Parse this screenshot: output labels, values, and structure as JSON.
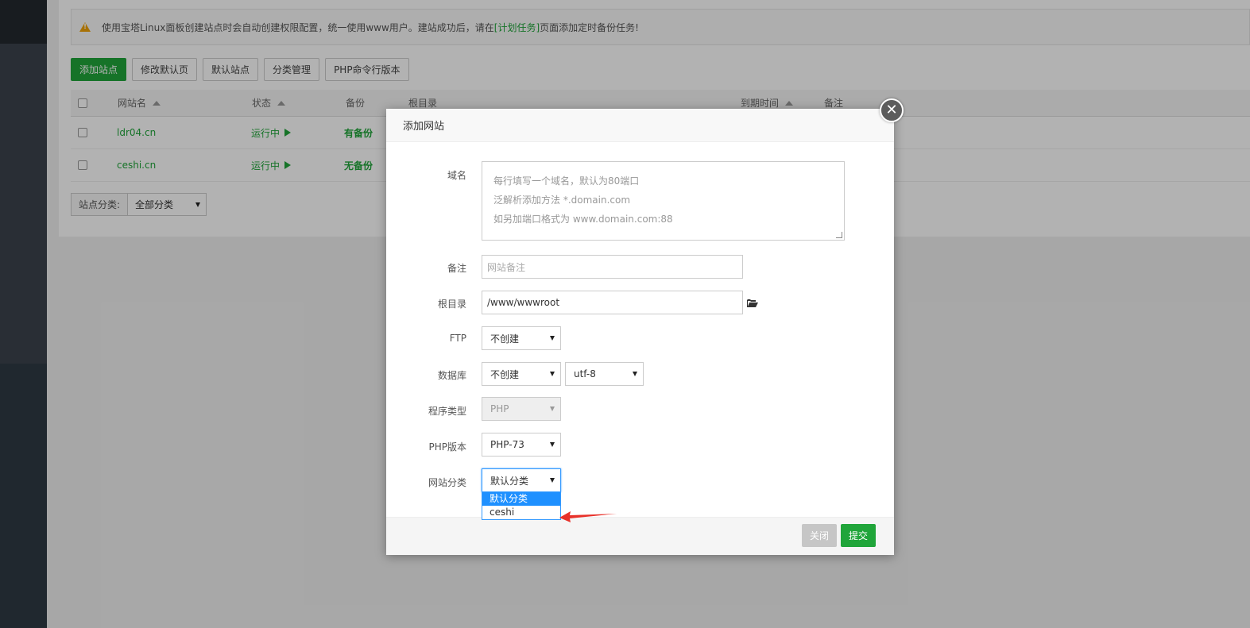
{
  "alert": {
    "text_before": "使用宝塔Linux面板创建站点时会自动创建权限配置，统一使用www用户。建站成功后，请在",
    "link": "[计划任务]",
    "text_after": "页面添加定时备份任务!"
  },
  "toolbar": {
    "add_site": "添加站点",
    "edit_default_page": "修改默认页",
    "default_site": "默认站点",
    "category_manage": "分类管理",
    "php_cli_version": "PHP命令行版本"
  },
  "table": {
    "headers": {
      "site_name": "网站名",
      "status": "状态",
      "backup": "备份",
      "root": "根目录",
      "expire": "到期时间",
      "remark": "备注"
    },
    "rows": [
      {
        "site": "ldr04.cn",
        "status": "运行中",
        "backup": "有备份"
      },
      {
        "site": "ceshi.cn",
        "status": "运行中",
        "backup": "无备份"
      }
    ]
  },
  "category_filter": {
    "label": "站点分类:",
    "selected": "全部分类"
  },
  "modal": {
    "title": "添加网站",
    "close_icon": "close-icon",
    "labels": {
      "domain": "域名",
      "remark": "备注",
      "root": "根目录",
      "ftp": "FTP",
      "database": "数据库",
      "program_type": "程序类型",
      "php_version": "PHP版本",
      "site_category": "网站分类"
    },
    "domain_placeholder": [
      "每行填写一个域名，默认为80端口",
      "泛解析添加方法 *.domain.com",
      "如另加端口格式为 www.domain.com:88"
    ],
    "remark_placeholder": "网站备注",
    "root_value": "/www/wwwroot",
    "ftp_selected": "不创建",
    "db_selected": "不创建",
    "db_charset": "utf-8",
    "program_type": "PHP",
    "php_version": "PHP-73",
    "category_selected": "默认分类",
    "category_options": [
      "默认分类",
      "ceshi"
    ],
    "buttons": {
      "close": "关闭",
      "submit": "提交"
    }
  },
  "colors": {
    "brand_green": "#20a53a",
    "select_highlight": "#1e90ff",
    "arrow_red": "#e8312a"
  }
}
